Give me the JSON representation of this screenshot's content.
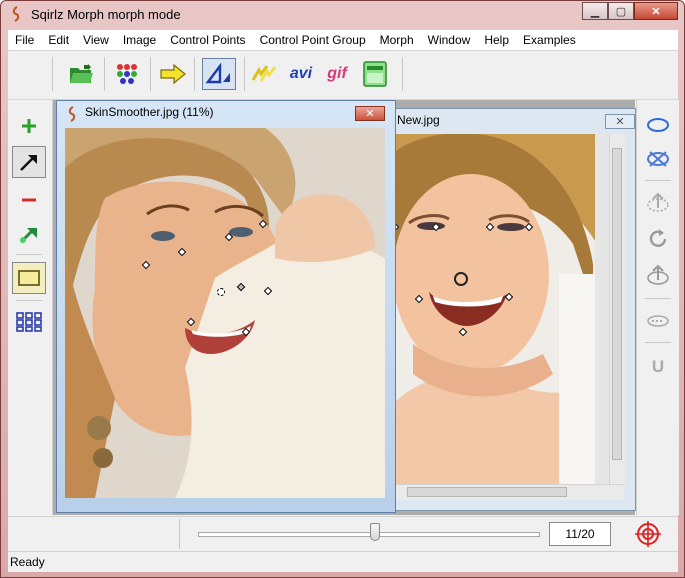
{
  "window": {
    "title": "Sqirlz Morph    morph mode",
    "min_glyph": "▁",
    "max_glyph": "▢",
    "close_glyph": "✕"
  },
  "menu": [
    "File",
    "Edit",
    "View",
    "Image",
    "Control Points",
    "Control Point Group",
    "Morph",
    "Window",
    "Help",
    "Examples"
  ],
  "toolbar": {
    "avi_label": "avi",
    "gif_label": "gif"
  },
  "documents": {
    "front": {
      "title": "SkinSmoother.jpg  (11%)",
      "close_glyph": "✕"
    },
    "back": {
      "title": "New.jpg",
      "close_glyph": "✕"
    }
  },
  "right_toolbar": {
    "u_label": "U"
  },
  "frame_counter": "11/20",
  "frame_position": 0.55,
  "status": "Ready",
  "colors": {
    "title_bar": "#d9a9a9",
    "mdi_background": "#ababab",
    "doc_title_active": "#cfe0f1"
  }
}
